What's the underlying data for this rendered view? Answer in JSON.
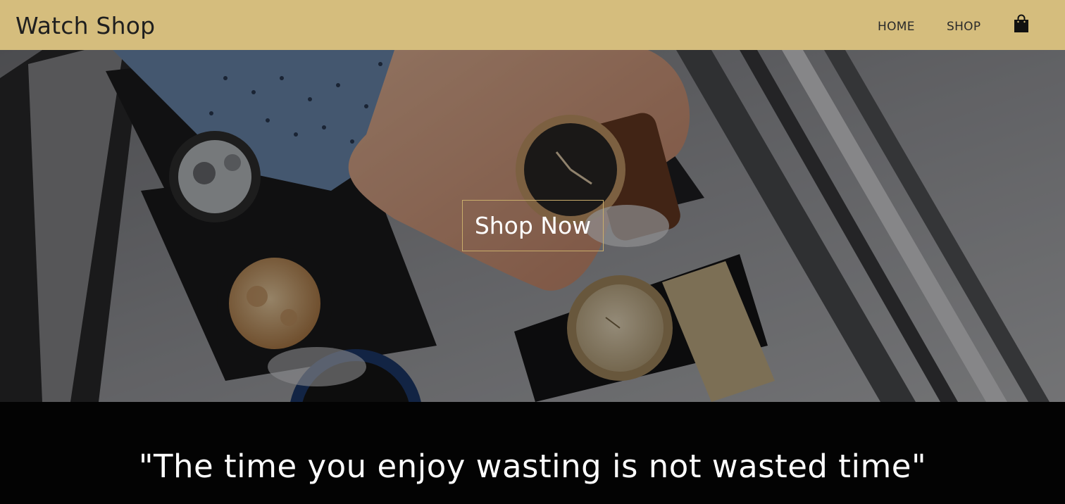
{
  "navbar": {
    "brand": "Watch Shop",
    "links": [
      {
        "label": "HOME"
      },
      {
        "label": "SHOP"
      }
    ],
    "cart_icon": "shopping-bag-icon",
    "background_color": "#d5bd7d"
  },
  "hero": {
    "cta_label": "Shop Now",
    "image_description_icon": "watch-collection-photo",
    "button_border_color": "#c9ad6b"
  },
  "quote_section": {
    "quote": "\"The time you enjoy wasting is not wasted time\"",
    "background_color": "#030303"
  }
}
